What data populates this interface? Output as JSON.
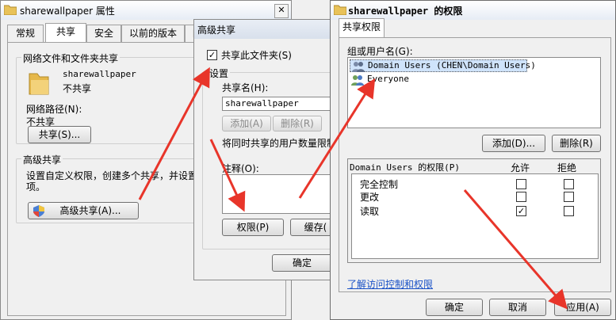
{
  "props": {
    "title": "sharewallpaper 属性",
    "tabs": [
      "常规",
      "共享",
      "安全",
      "以前的版本",
      "自"
    ],
    "network_group": "网络文件和文件夹共享",
    "folder_name": "sharewallpaper",
    "share_status": "不共享",
    "path_label": "网络路径(N):",
    "path_value": "不共享",
    "share_button": "共享(S)...",
    "advanced_group": "高级共享",
    "advanced_desc_1": "设置自定义权限，创建多个共享，并设置",
    "advanced_desc_2": "项。",
    "advanced_button": "高级共享(A)..."
  },
  "advanced": {
    "title": "高级共享",
    "share_checkbox": "共享此文件夹(S)",
    "settings_group": "设置",
    "share_name_label": "共享名(H):",
    "share_name_value": "sharewallpaper",
    "add_button": "添加(A)",
    "delete_button": "删除(R)",
    "limit_label": "将同时共享的用户数量限制",
    "comment_label": "注释(O):",
    "permissions_button": "权限(P)",
    "cache_button": "缓存(",
    "ok_button": "确定"
  },
  "perms": {
    "title": "sharewallpaper 的权限",
    "tab": "共享权限",
    "group_label": "组或用户名(G):",
    "users": [
      "Domain Users (CHEN\\Domain Users)",
      "Everyone"
    ],
    "add_button": "添加(D)...",
    "delete_button": "删除(R)",
    "perm_header": "Domain Users 的权限(P)",
    "allow": "允许",
    "deny": "拒绝",
    "rows": [
      {
        "name": "完全控制",
        "allow": false,
        "deny": false
      },
      {
        "name": "更改",
        "allow": false,
        "deny": false
      },
      {
        "name": "读取",
        "allow": true,
        "deny": false
      }
    ],
    "link": "了解访问控制和权限",
    "ok_button": "确定",
    "cancel_button": "取消",
    "apply_button": "应用(A)"
  },
  "colors": {
    "arrow": "#e8352a",
    "selection": "#cfe3fb"
  }
}
